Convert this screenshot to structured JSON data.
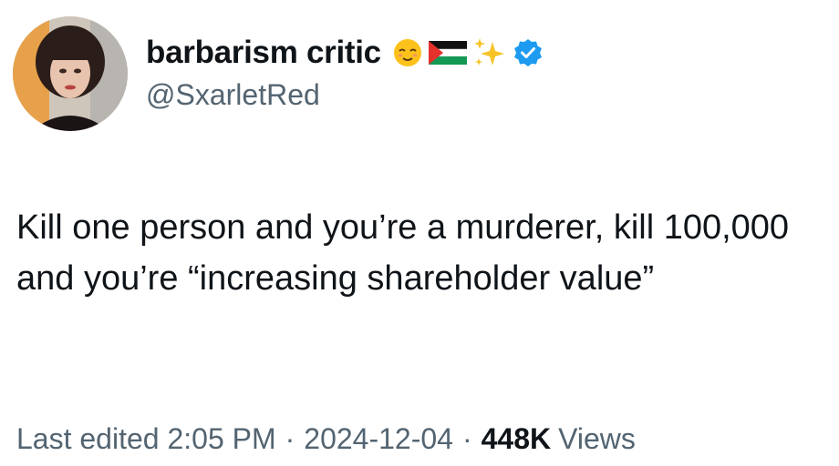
{
  "author": {
    "display_name": "barbarism critic",
    "handle": "@SxarletRed",
    "name_emojis": [
      "relieved-face-emoji",
      "palestine-flag-emoji",
      "sparkles-emoji"
    ],
    "verified": true
  },
  "tweet": {
    "text": "Kill one person and you’re a murderer, kill 100,000 and you’re “increasing shareholder value”"
  },
  "meta": {
    "edited_label": "Last edited",
    "time": "2:05 PM",
    "separator": "·",
    "date": "2024-12-04",
    "views_count": "448K",
    "views_label": "Views"
  },
  "colors": {
    "text_primary": "#0f1419",
    "text_secondary": "#536471",
    "verified_blue": "#1d9bf0"
  }
}
